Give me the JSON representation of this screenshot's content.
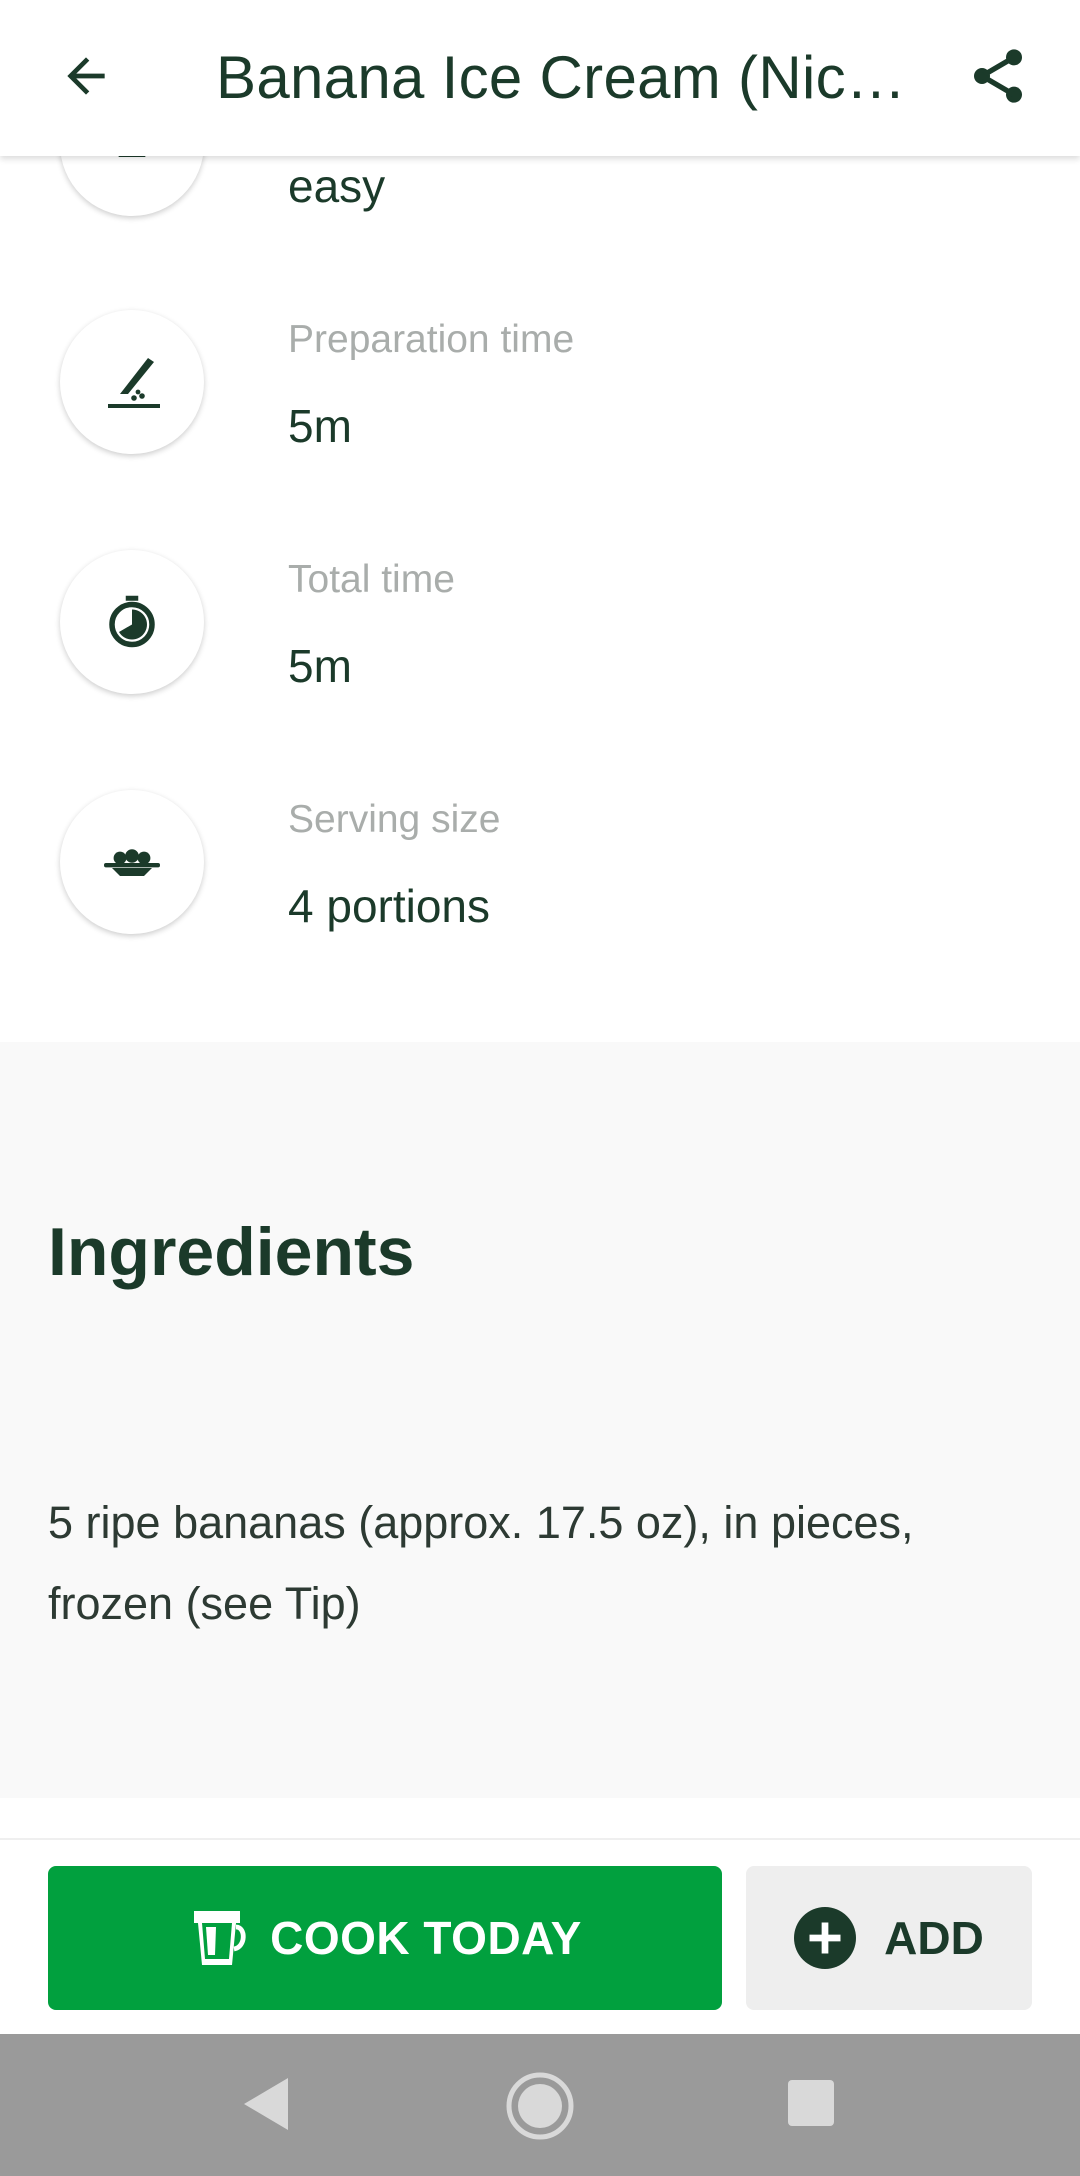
{
  "app_bar": {
    "title": "Banana Ice Cream (Nice Cream)",
    "back_icon": "arrow-left-icon",
    "share_icon": "share-icon"
  },
  "info_rows": [
    {
      "icon": "difficulty-icon",
      "label": "",
      "value": "easy"
    },
    {
      "icon": "knife-icon",
      "label": "Preparation time",
      "value": "5m"
    },
    {
      "icon": "timer-icon",
      "label": "Total time",
      "value": "5m"
    },
    {
      "icon": "dish-icon",
      "label": "Serving size",
      "value": "4 portions"
    }
  ],
  "ingredients": {
    "heading": "Ingredients",
    "items": [
      "5 ripe bananas (approx. 17.5 oz), in pieces, frozen (see Tip)"
    ]
  },
  "actions": {
    "cook_today_label": "COOK TODAY",
    "add_label": "ADD"
  },
  "colors": {
    "primary_green": "#01a03e",
    "text_dark_green": "#1b3a2a",
    "label_gray": "#a9adab"
  }
}
